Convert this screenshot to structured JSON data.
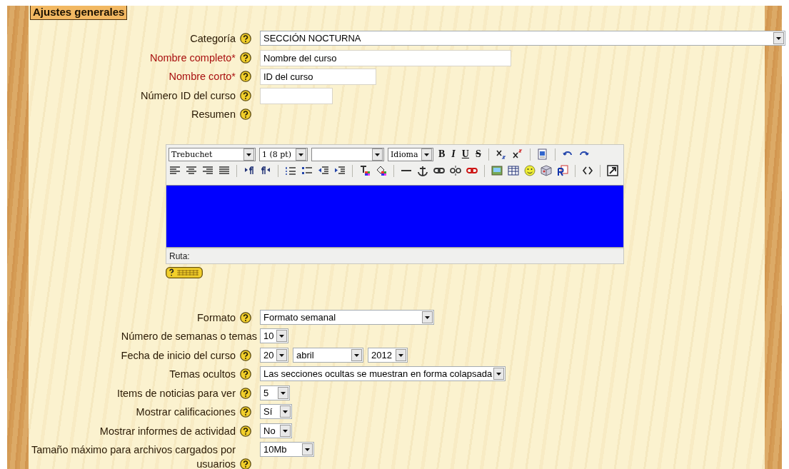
{
  "section": {
    "title": "Ajustes generales"
  },
  "fields_top": [
    {
      "label": "Categoría",
      "required": false,
      "help": true,
      "controls": [
        {
          "kind": "select",
          "value": "SECCIÓN NOCTURNA"
        }
      ]
    },
    {
      "label": "Nombre completo*",
      "required": true,
      "help": true,
      "controls": [
        {
          "kind": "text",
          "value": "Nombre del curso"
        }
      ]
    },
    {
      "label": "Nombre corto*",
      "required": true,
      "help": true,
      "controls": [
        {
          "kind": "text",
          "value": "ID del curso"
        }
      ]
    },
    {
      "label": "Número ID del curso",
      "required": false,
      "help": true,
      "controls": [
        {
          "kind": "text"
        }
      ]
    },
    {
      "label": "Resumen",
      "required": false,
      "help": true
    }
  ],
  "editor": {
    "toolbar": [
      {
        "kind": "select",
        "value": "Trebuchet"
      },
      {
        "kind": "select",
        "value": "1 (8 pt)"
      },
      {
        "kind": "select"
      },
      {
        "kind": "select",
        "value": "Idioma"
      },
      {
        "kind": "glyph",
        "text": "B"
      },
      {
        "kind": "glyph",
        "text": "I"
      },
      {
        "kind": "glyph",
        "text": "U"
      },
      {
        "kind": "glyph",
        "text": "S"
      }
    ],
    "path_label": "Ruta:"
  },
  "fields_bottom": [
    {
      "label": "Formato",
      "required": false,
      "help": true,
      "controls": [
        {
          "kind": "select",
          "value": "Formato semanal"
        }
      ]
    },
    {
      "label": "Número de semanas o temas",
      "required": false,
      "help": false,
      "controls": [
        {
          "kind": "select",
          "value": "10"
        }
      ]
    },
    {
      "label": "Fecha de inicio del curso",
      "required": false,
      "help": true,
      "controls": [
        {
          "kind": "select",
          "value": "20"
        },
        {
          "kind": "select",
          "value": "abril"
        },
        {
          "kind": "select",
          "value": "2012"
        }
      ]
    },
    {
      "label": "Temas ocultos",
      "required": false,
      "help": true,
      "controls": [
        {
          "kind": "select",
          "value": "Las secciones ocultas se muestran en forma colapsada"
        }
      ]
    },
    {
      "label": "Items de noticias para ver",
      "required": false,
      "help": true,
      "controls": [
        {
          "kind": "select",
          "value": "5"
        }
      ]
    },
    {
      "label": "Mostrar calificaciones",
      "required": false,
      "help": true,
      "controls": [
        {
          "kind": "select",
          "value": "Sí"
        }
      ]
    },
    {
      "label": "Mostrar informes de actividad",
      "required": false,
      "help": true,
      "controls": [
        {
          "kind": "select",
          "value": "No"
        }
      ]
    },
    {
      "label": "Tamaño máximo para archivos cargados por usuarios",
      "required": false,
      "help": true,
      "controls": [
        {
          "kind": "select",
          "value": "10Mb"
        }
      ]
    }
  ]
}
